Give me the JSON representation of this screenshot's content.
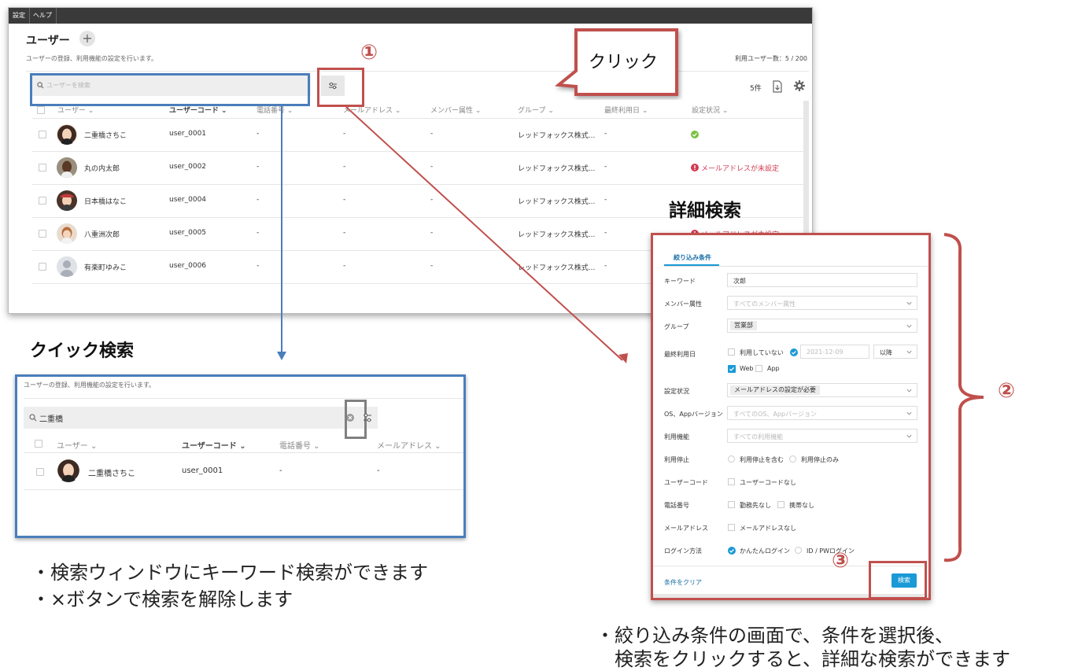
{
  "menu": {
    "items": [
      "設定",
      "ヘルプ"
    ]
  },
  "main": {
    "title": "ユーザー",
    "add_symbol": "+",
    "subtitle": "ユーザーの登録、利用機能の設定を行います。",
    "user_count": "利用ユーザー数：5 / 200",
    "search_placeholder": "ユーザーを検索",
    "row_count": "5件",
    "columns": [
      "ユーザー",
      "ユーザーコード",
      "電話番号",
      "メールアドレス",
      "メンバー属性",
      "グループ",
      "最終利用日",
      "設定状況"
    ],
    "rows": [
      {
        "name": "二重橋さちこ",
        "code": "user_0001",
        "phone": "-",
        "email": "-",
        "attr": "-",
        "group": "レッドフォックス株式...",
        "last": "-",
        "status": ""
      },
      {
        "name": "丸の内太郎",
        "code": "user_0002",
        "phone": "-",
        "email": "-",
        "attr": "-",
        "group": "レッドフォックス株式...",
        "last": "-",
        "status": "メールアドレスが未設定"
      },
      {
        "name": "日本橋はなこ",
        "code": "user_0004",
        "phone": "-",
        "email": "-",
        "attr": "-",
        "group": "レッドフォックス株式...",
        "last": "-",
        "status": ""
      },
      {
        "name": "八重洲次郎",
        "code": "user_0005",
        "phone": "-",
        "email": "-",
        "attr": "-",
        "group": "レッドフォックス株式...",
        "last": "-",
        "status": "メールアドレスが未設定"
      },
      {
        "name": "有楽町ゆみこ",
        "code": "user_0006",
        "phone": "-",
        "email": "-",
        "attr": "-",
        "group": "レッドフォックス株式...",
        "last": "-",
        "status": ""
      }
    ]
  },
  "callout": {
    "click_label": "クリック",
    "num1": "①",
    "num2": "②",
    "num3": "③"
  },
  "quick": {
    "title": "クイック検索",
    "subtitle": "ユーザーの登録、利用機能の設定を行います。",
    "search_value": "二重橋",
    "columns": [
      "ユーザー",
      "ユーザーコード",
      "電話番号",
      "メールアドレス"
    ],
    "row": {
      "name": "二重橋さちこ",
      "code": "user_0001",
      "phone": "-",
      "email": "-"
    },
    "notes": [
      "・検索ウィンドウにキーワード検索ができます",
      "・×ボタンで検索を解除します"
    ]
  },
  "detail": {
    "title": "詳細検索",
    "tab": "絞り込み条件",
    "fields": {
      "keyword_label": "キーワード",
      "keyword_value": "次郎",
      "attr_label": "メンバー属性",
      "attr_ph": "すべてのメンバー属性",
      "group_label": "グループ",
      "group_value": "営業部",
      "last_label": "最終利用日",
      "last_unused": "利用していない",
      "last_date": "2021-12-09",
      "last_after": "以降",
      "web": "Web",
      "app": "App",
      "status_label": "設定状況",
      "status_value": "メールアドレスの設定が必要",
      "os_label": "OS、Appバージョン",
      "os_ph": "すべてのOS、Appバージョン",
      "func_label": "利用機能",
      "func_ph": "すべての利用機能",
      "stop_label": "利用停止",
      "stop_include": "利用停止を含む",
      "stop_only": "利用停止のみ",
      "code_label": "ユーザーコード",
      "code_none": "ユーザーコードなし",
      "phone_label": "電話番号",
      "phone_office": "勤務先なし",
      "phone_mobile": "携帯なし",
      "mail_label": "メールアドレス",
      "mail_none": "メールアドレスなし",
      "login_label": "ログイン方法",
      "login_easy": "かんたんログイン",
      "login_idpw": "ID / PWログイン"
    },
    "clear": "条件をクリア",
    "search_button": "検索",
    "notes": [
      "・絞り込み条件の画面で、条件を選択後、",
      "　検索をクリックすると、詳細な検索ができます"
    ]
  },
  "colors": {
    "blue": "#4a7ebb",
    "red": "#c0504d",
    "accent": "#1a9ad6",
    "ok": "#7ac142",
    "warn": "#d33b52"
  }
}
